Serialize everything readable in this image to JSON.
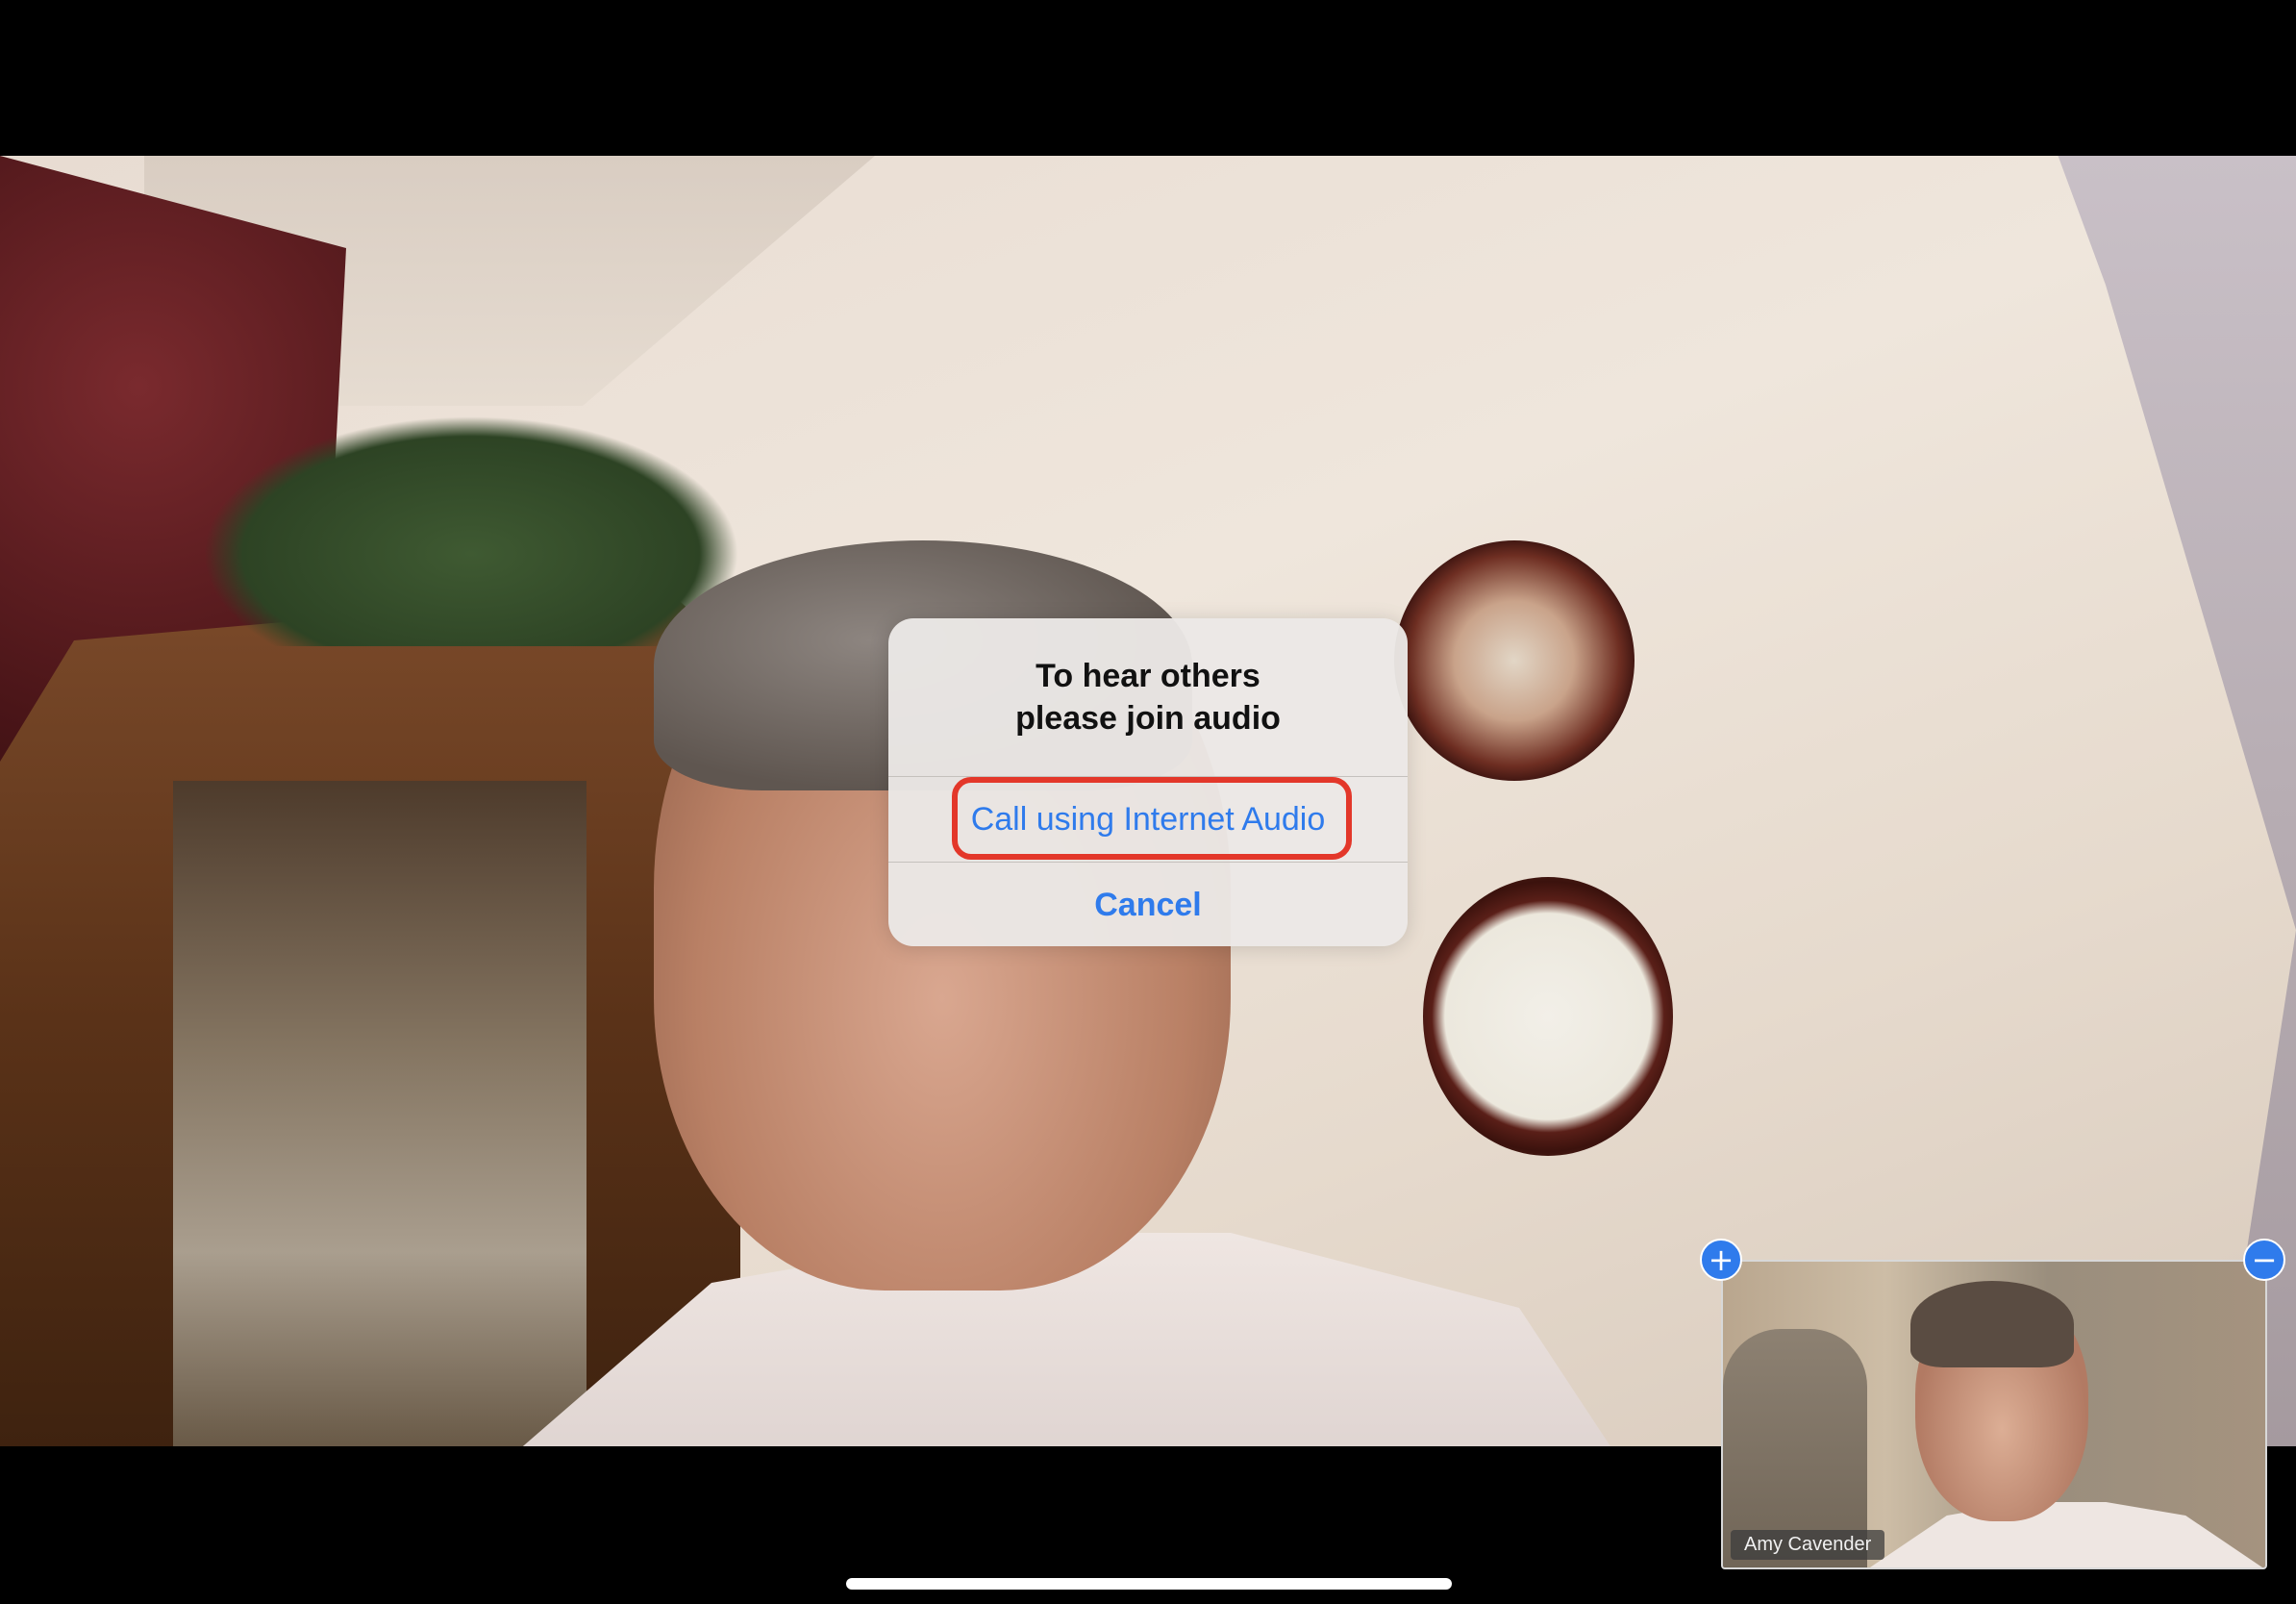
{
  "dialog": {
    "title_line1": "To hear others",
    "title_line2": "please join audio",
    "primary_label": "Call using Internet Audio",
    "cancel_label": "Cancel"
  },
  "self_view": {
    "participant_name": "Amy Cavender",
    "expand_icon": "+",
    "minimize_icon": "−"
  },
  "colors": {
    "accent": "#2f7bec",
    "highlight": "#e3372a"
  }
}
